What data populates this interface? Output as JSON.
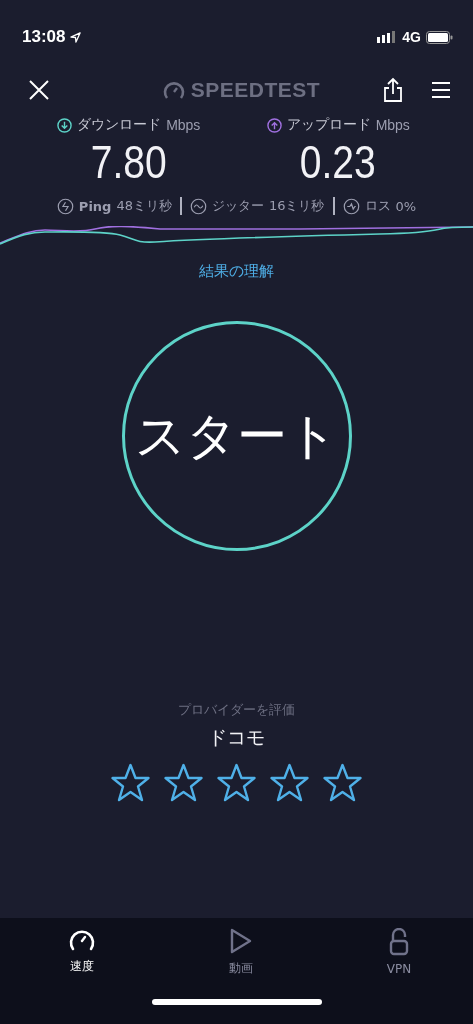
{
  "status_bar": {
    "time": "13:08",
    "network": "4G"
  },
  "header": {
    "logo": "SPEEDTEST"
  },
  "results": [
    {
      "kind": "download",
      "label": "ダウンロード",
      "unit": "Mbps",
      "value": "7.80"
    },
    {
      "kind": "upload",
      "label": "アップロード",
      "unit": "Mbps",
      "value": "0.23"
    }
  ],
  "metrics": [
    {
      "kind": "ping",
      "label": "Ping",
      "value": "48ミリ秒"
    },
    {
      "kind": "jitter",
      "label": "ジッター",
      "value": "16ミリ秒"
    },
    {
      "kind": "loss",
      "label": "ロス",
      "value": "0%"
    }
  ],
  "results_link": "結果の理解",
  "start_button": "スタート",
  "rating": {
    "prompt": "プロバイダーを評価",
    "provider": "ドコモ",
    "stars": 0
  },
  "tabs": [
    {
      "kind": "speed",
      "label": "速度",
      "selected": true
    },
    {
      "kind": "video",
      "label": "動画",
      "selected": false
    },
    {
      "kind": "vpn",
      "label": "VPN",
      "selected": false
    }
  ]
}
